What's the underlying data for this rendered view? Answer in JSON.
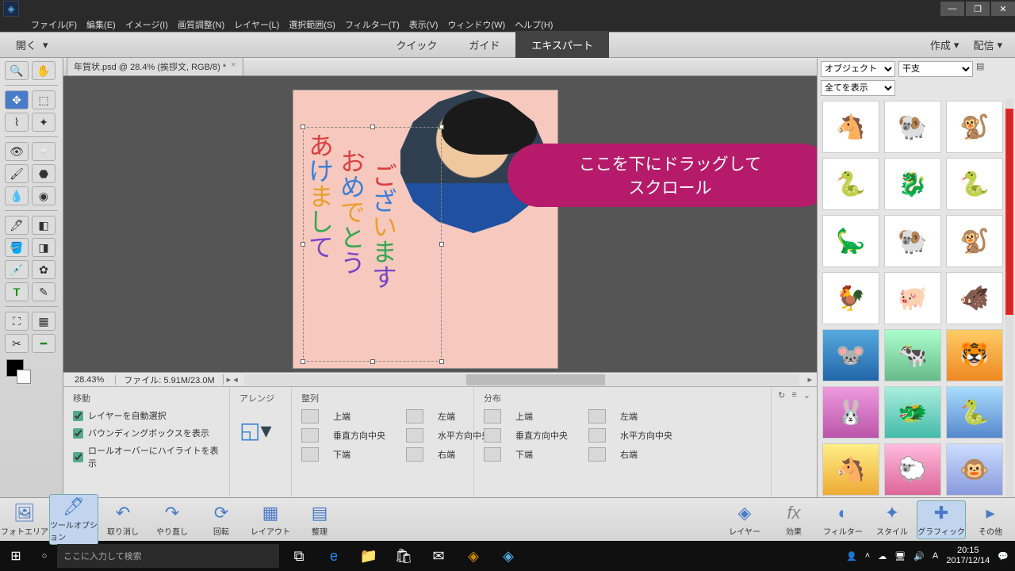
{
  "titlebar": {
    "winMin": "—",
    "winMax": "❐",
    "winClose": "✕"
  },
  "menu": {
    "file": "ファイル(F)",
    "edit": "編集(E)",
    "image": "イメージ(I)",
    "adjust": "画質調整(N)",
    "layer": "レイヤー(L)",
    "select": "選択範囲(S)",
    "filter": "フィルター(T)",
    "view": "表示(V)",
    "window": "ウィンドウ(W)",
    "help": "ヘルプ(H)"
  },
  "modebar": {
    "open": "開く",
    "quick": "クイック",
    "guide": "ガイド",
    "expert": "エキスパート",
    "create": "作成",
    "share": "配信"
  },
  "doc": {
    "tab": "年賀状.psd @ 28.4% (挨拶文, RGB/8) *",
    "zoom": "28.43%",
    "file": "ファイル: 5.91M/23.0M"
  },
  "text": {
    "l1": "あけま",
    "l2": "おめでと",
    "l3": "ございます"
  },
  "bubble": {
    "l1": "ここを下にドラッグして",
    "l2": "スクロール"
  },
  "options": {
    "title": "移動",
    "arrange": "アレンジ",
    "align": "整列",
    "distribute": "分布",
    "chk1": "レイヤーを自動選択",
    "chk2": "バウンディングボックスを表示",
    "chk3": "ロールオーバーにハイライトを表示",
    "topE": "上端",
    "leftE": "左端",
    "vCenter": "垂直方向中央",
    "hCenter": "水平方向中央",
    "bottomE": "下端",
    "rightE": "右端"
  },
  "rightPanel": {
    "filter1": "オブジェクト",
    "filter2": "干支",
    "filter3": "全てを表示"
  },
  "bottombar": {
    "photoBin": "フォトエリア",
    "toolOpt": "ツールオプション",
    "undo": "取り消し",
    "redo": "やり直し",
    "rotate": "回転",
    "layout": "レイアウト",
    "org": "整理",
    "layers": "レイヤー",
    "effects": "効果",
    "filters": "フィルター",
    "styles": "スタイル",
    "graphics": "グラフィック",
    "more": "その他"
  },
  "taskbar": {
    "search": "ここに入力して検索",
    "time": "20:15",
    "date": "2017/12/14"
  }
}
